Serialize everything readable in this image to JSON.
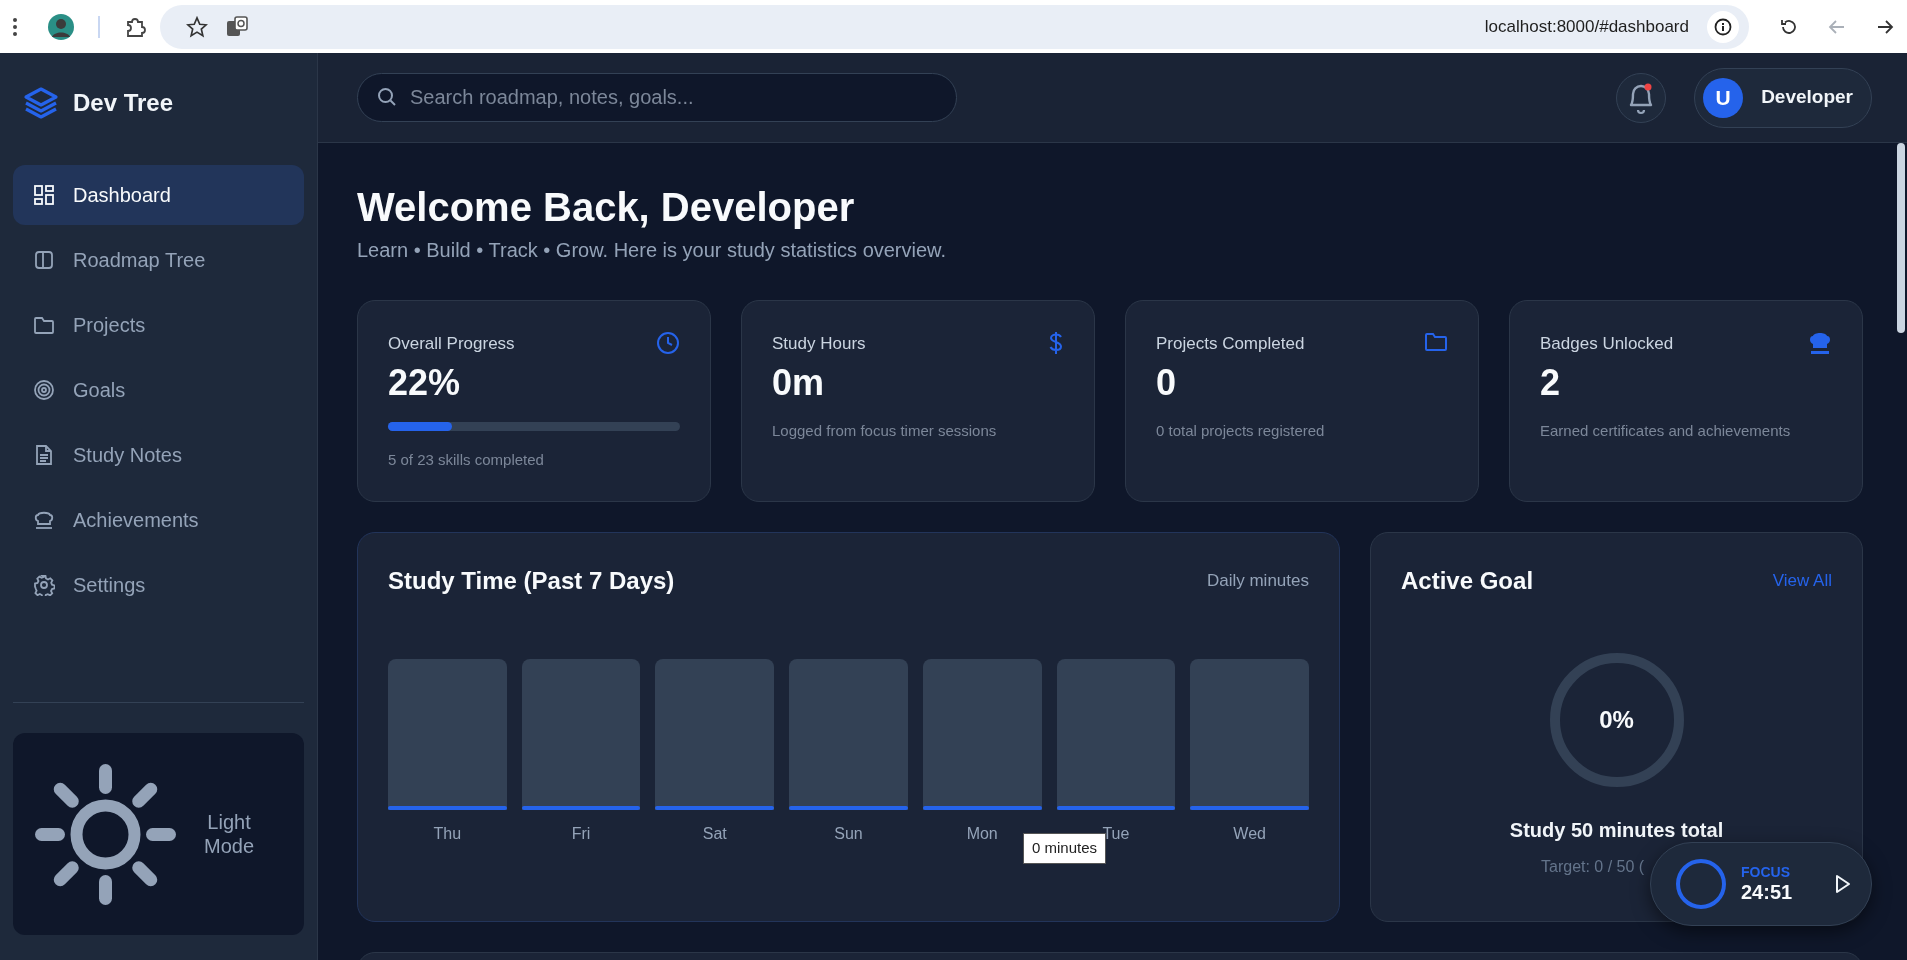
{
  "browser": {
    "url": "localhost:8000/#dashboard",
    "back_disabled": true
  },
  "brand": "Dev Tree",
  "nav": [
    {
      "label": "Dashboard",
      "selected": true
    },
    {
      "label": "Roadmap Tree",
      "selected": false
    },
    {
      "label": "Projects",
      "selected": false
    },
    {
      "label": "Goals",
      "selected": false
    },
    {
      "label": "Study Notes",
      "selected": false
    },
    {
      "label": "Achievements",
      "selected": false
    },
    {
      "label": "Settings",
      "selected": false
    }
  ],
  "theme_toggle": {
    "label": "Light Mode"
  },
  "search": {
    "placeholder": "Search roadmap, notes, goals..."
  },
  "notifications": {
    "unread": true
  },
  "user": {
    "initial": "U",
    "name": "Developer"
  },
  "welcome": {
    "title": "Welcome Back, Developer",
    "subtitle": "Learn • Build • Track • Grow. Here is your study statistics overview."
  },
  "stats": [
    {
      "label": "Overall Progress",
      "value": "22%",
      "level": 0.22,
      "note": "5 of 23 skills completed"
    },
    {
      "label": "Study Hours",
      "value": "0m",
      "note": "Logged from focus timer sessions"
    },
    {
      "label": "Projects Completed",
      "value": "0",
      "note": "0 total projects registered"
    },
    {
      "label": "Badges Unlocked",
      "value": "2",
      "note": "Earned certificates and achievements"
    }
  ],
  "study_time": {
    "title": "Study Time (Past 7 Days)",
    "unit": "Daily minutes",
    "tooltip": "0 minutes",
    "days": [
      {
        "label": "Thu",
        "level": 0
      },
      {
        "label": "Fri",
        "level": 0
      },
      {
        "label": "Sat",
        "level": 0
      },
      {
        "label": "Sun",
        "level": 0
      },
      {
        "label": "Mon",
        "level": 0
      },
      {
        "label": "Tue",
        "level": 0
      },
      {
        "label": "Wed",
        "level": 0
      }
    ]
  },
  "active_goal": {
    "title": "Active Goal",
    "link": "View All",
    "percent": "0%",
    "name": "Study 50 minutes total",
    "target": "Target: 0 / 50 ("
  },
  "focus_timer": {
    "label": "FOCUS",
    "time": "24:51"
  }
}
